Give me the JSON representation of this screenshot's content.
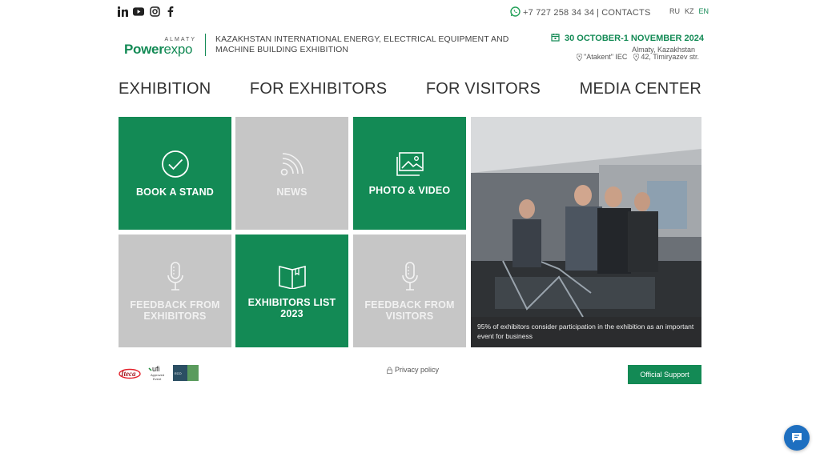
{
  "topbar": {
    "social": [
      "linkedin-icon",
      "youtube-icon",
      "instagram-icon",
      "facebook-icon"
    ],
    "phone": "+7 727 258 34 34",
    "separator": "|",
    "contacts": "CONTACTS",
    "languages": [
      "RU",
      "KZ",
      "EN"
    ],
    "active_language": "EN"
  },
  "header": {
    "logo": {
      "city": "ALMATY",
      "word_a": "Power",
      "word_b": "expo"
    },
    "title": "KAZAKHSTAN INTERNATIONAL ENERGY, ELECTRICAL EQUIPMENT AND MACHINE BUILDING EXHIBITION",
    "dates": "30 OCTOBER-1 NOVEMBER 2024",
    "city": "Almaty, Kazakhstan",
    "venue": "\"Atakent\" IEC",
    "address": "42, Timiryazev str."
  },
  "nav": {
    "items": [
      "EXHIBITION",
      "FOR EXHIBITORS",
      "FOR VISITORS",
      "MEDIA CENTER"
    ]
  },
  "tiles": [
    {
      "label": "BOOK A STAND",
      "icon": "check-circle-icon",
      "color": "green"
    },
    {
      "label": "NEWS",
      "icon": "rss-icon",
      "color": "grey"
    },
    {
      "label": "PHOTO & VIDEO",
      "icon": "gallery-icon",
      "color": "green"
    },
    {
      "label": "FEEDBACK FROM EXHIBITORS",
      "icon": "microphone-icon",
      "color": "grey"
    },
    {
      "label": "EXHIBITORS LIST 2023",
      "icon": "book-icon",
      "color": "green"
    },
    {
      "label": "FEEDBACK FROM VISITORS",
      "icon": "microphone-icon",
      "color": "grey"
    }
  ],
  "photo": {
    "caption": "95% of exhibitors consider participation in the exhibition as an important event for business"
  },
  "footer": {
    "partner_logos": [
      "iteca-logo",
      "ufi-logo",
      "partner-logo"
    ],
    "ufi_text": "ufi",
    "ufi_sub": "Approved Event",
    "iteca_text": "Iteca",
    "privacy": "Privacy policy",
    "support": "Official Support"
  },
  "colors": {
    "brand_green": "#138a55",
    "tile_grey": "#c6c6c6",
    "chat_blue": "#1e6fc0"
  }
}
